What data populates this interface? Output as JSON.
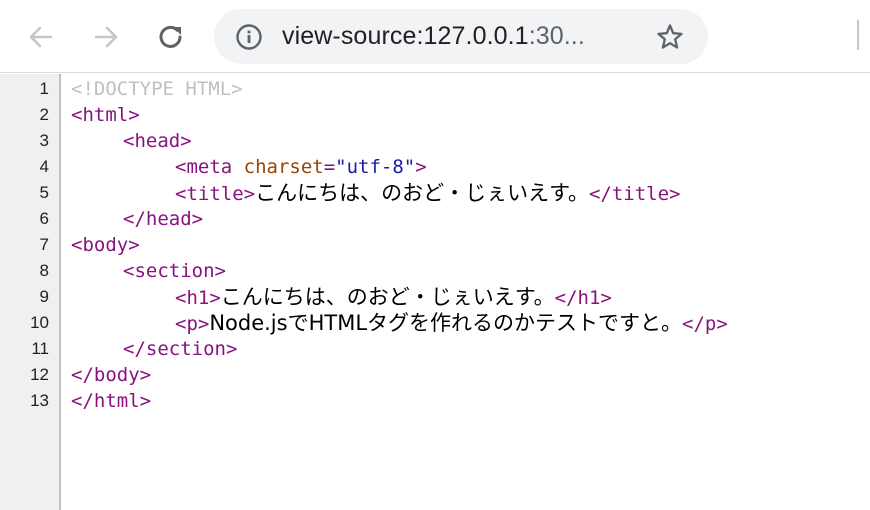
{
  "toolbar": {
    "back_icon": "arrow-left-icon",
    "forward_icon": "arrow-right-icon",
    "reload_icon": "reload-icon",
    "omnibox": {
      "info_icon": "info-icon",
      "url_host": "view-source:127.0.0.1",
      "url_rest": ":30...",
      "star_icon": "star-icon"
    }
  },
  "source": {
    "line_numbers": [
      "1",
      "2",
      "3",
      "4",
      "5",
      "6",
      "7",
      "8",
      "9",
      "10",
      "11",
      "12",
      "13"
    ],
    "lines": {
      "l1": {
        "doctype": "<!DOCTYPE HTML>"
      },
      "l2": {
        "open": "<html>"
      },
      "l3": {
        "open": "<head>"
      },
      "l4": {
        "tag_start": "<meta ",
        "attr": "charset",
        "eq": "=",
        "value": "\"utf-8\"",
        "tag_end": ">"
      },
      "l5": {
        "open": "<title>",
        "text": "こんにちは、のおど・じぇいえす。",
        "close": "</title>"
      },
      "l6": {
        "close": "</head>"
      },
      "l7": {
        "open": "<body>"
      },
      "l8": {
        "open": "<section>"
      },
      "l9": {
        "open": "<h1>",
        "text": "こんにちは、のおど・じぇいえす。",
        "close": "</h1>"
      },
      "l10": {
        "open": "<p>",
        "text": "Node.jsでHTMLタグを作れるのかテストですと。",
        "close": "</p>"
      },
      "l11": {
        "close": "</section>"
      },
      "l12": {
        "close": "</body>"
      },
      "l13": {
        "close": "</html>"
      }
    }
  },
  "colors": {
    "tag": "#881280",
    "attribute": "#994500",
    "value": "#1a1aa6",
    "doctype": "#c0c0c0",
    "gutter_bg": "#f0f0f0",
    "omnibox_bg": "#f1f3f4"
  }
}
